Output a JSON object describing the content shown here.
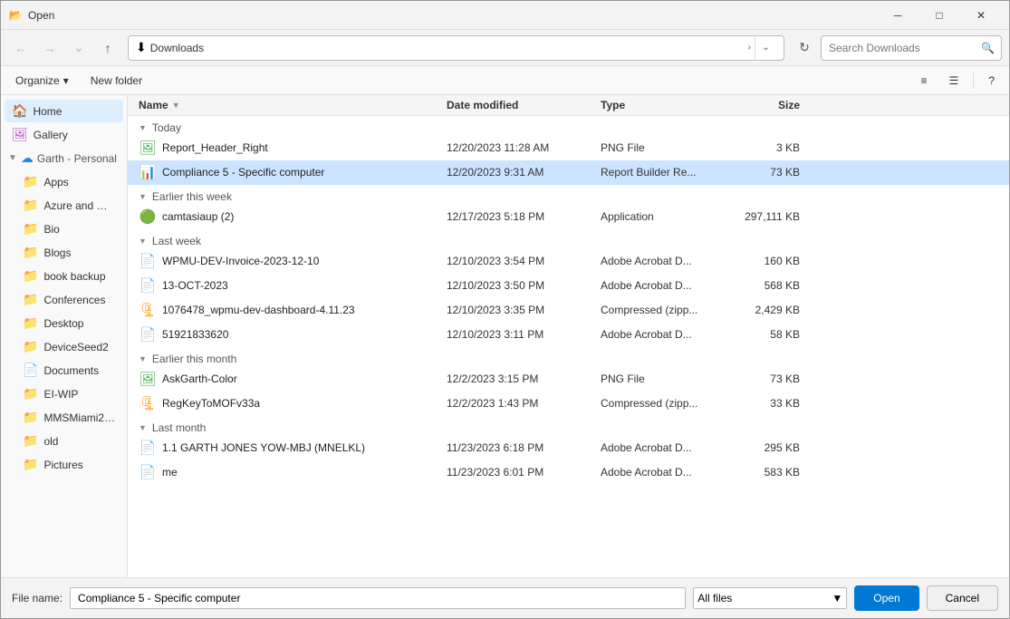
{
  "window": {
    "title": "Open",
    "title_icon": "📂"
  },
  "title_buttons": {
    "minimize": "─",
    "maximize": "□",
    "close": "✕"
  },
  "toolbar": {
    "back": "←",
    "forward": "→",
    "recent_locations": "⌄",
    "up": "↑",
    "download_icon": "⬇",
    "address": "Downloads",
    "address_chevron": "›",
    "refresh": "↻",
    "search_placeholder": "Search Downloads"
  },
  "secondary_toolbar": {
    "organize_label": "Organize",
    "organize_chevron": "▾",
    "new_folder_label": "New folder",
    "view_icons": "⊞",
    "view_details": "☰",
    "help": "?"
  },
  "sidebar": {
    "items": [
      {
        "id": "home",
        "icon": "🏠",
        "label": "Home",
        "selected": true,
        "indent": 0
      },
      {
        "id": "gallery",
        "icon": "🖼",
        "label": "Gallery",
        "selected": false,
        "indent": 0
      },
      {
        "id": "garth-personal",
        "icon": "☁",
        "label": "Garth - Personal",
        "selected": false,
        "indent": 0,
        "expandable": true,
        "expanded": true
      },
      {
        "id": "apps",
        "icon": "📁",
        "label": "Apps",
        "selected": false,
        "indent": 1
      },
      {
        "id": "azure",
        "icon": "📁",
        "label": "Azure and Mo...",
        "selected": false,
        "indent": 1
      },
      {
        "id": "bio",
        "icon": "📁",
        "label": "Bio",
        "selected": false,
        "indent": 1
      },
      {
        "id": "blogs",
        "icon": "📁",
        "label": "Blogs",
        "selected": false,
        "indent": 1
      },
      {
        "id": "book-backup",
        "icon": "📁",
        "label": "book backup",
        "selected": false,
        "indent": 1
      },
      {
        "id": "conferences",
        "icon": "📁",
        "label": "Conferences",
        "selected": false,
        "indent": 1
      },
      {
        "id": "desktop",
        "icon": "📁",
        "label": "Desktop",
        "selected": false,
        "indent": 1
      },
      {
        "id": "deviceseed2",
        "icon": "📁",
        "label": "DeviceSeed2",
        "selected": false,
        "indent": 1
      },
      {
        "id": "documents",
        "icon": "📄",
        "label": "Documents",
        "selected": false,
        "indent": 1
      },
      {
        "id": "el-wip",
        "icon": "📁",
        "label": "EI-WIP",
        "selected": false,
        "indent": 1
      },
      {
        "id": "mmsMiami202",
        "icon": "📁",
        "label": "MMSMiami202...",
        "selected": false,
        "indent": 1
      },
      {
        "id": "old",
        "icon": "📁",
        "label": "old",
        "selected": false,
        "indent": 1
      },
      {
        "id": "pictures",
        "icon": "📁",
        "label": "Pictures",
        "selected": false,
        "indent": 1
      }
    ]
  },
  "file_list": {
    "columns": {
      "name": "Name",
      "date": "Date modified",
      "type": "Type",
      "size": "Size",
      "sort_arrow": "▼"
    },
    "groups": [
      {
        "label": "Today",
        "files": [
          {
            "icon": "🖼",
            "icon_type": "png",
            "name": "Report_Header_Right",
            "date": "12/20/2023 11:28 AM",
            "type": "PNG File",
            "size": "3 KB",
            "selected": false
          },
          {
            "icon": "📊",
            "icon_type": "report",
            "name": "Compliance 5 - Specific computer",
            "date": "12/20/2023 9:31 AM",
            "type": "Report Builder Re...",
            "size": "73 KB",
            "selected": true
          }
        ]
      },
      {
        "label": "Earlier this week",
        "files": [
          {
            "icon": "🟢",
            "icon_type": "app",
            "name": "camtasiaup (2)",
            "date": "12/17/2023 5:18 PM",
            "type": "Application",
            "size": "297,111 KB",
            "selected": false
          }
        ]
      },
      {
        "label": "Last week",
        "files": [
          {
            "icon": "📄",
            "icon_type": "pdf",
            "name": "WPMU-DEV-Invoice-2023-12-10",
            "date": "12/10/2023 3:54 PM",
            "type": "Adobe Acrobat D...",
            "size": "160 KB",
            "selected": false
          },
          {
            "icon": "📄",
            "icon_type": "pdf",
            "name": "13-OCT-2023",
            "date": "12/10/2023 3:50 PM",
            "type": "Adobe Acrobat D...",
            "size": "568 KB",
            "selected": false
          },
          {
            "icon": "🗜",
            "icon_type": "zip",
            "name": "1076478_wpmu-dev-dashboard-4.11.23",
            "date": "12/10/2023 3:35 PM",
            "type": "Compressed (zipp...",
            "size": "2,429 KB",
            "selected": false
          },
          {
            "icon": "📄",
            "icon_type": "pdf",
            "name": "51921833620",
            "date": "12/10/2023 3:11 PM",
            "type": "Adobe Acrobat D...",
            "size": "58 KB",
            "selected": false
          }
        ]
      },
      {
        "label": "Earlier this month",
        "files": [
          {
            "icon": "🖼",
            "icon_type": "png",
            "name": "AskGarth-Color",
            "date": "12/2/2023 3:15 PM",
            "type": "PNG File",
            "size": "73 KB",
            "selected": false
          },
          {
            "icon": "🗜",
            "icon_type": "zip",
            "name": "RegKeyToMOFv33a",
            "date": "12/2/2023 1:43 PM",
            "type": "Compressed (zipp...",
            "size": "33 KB",
            "selected": false
          }
        ]
      },
      {
        "label": "Last month",
        "files": [
          {
            "icon": "📄",
            "icon_type": "pdf",
            "name": "1.1 GARTH JONES YOW-MBJ (MNELKL)",
            "date": "11/23/2023 6:18 PM",
            "type": "Adobe Acrobat D...",
            "size": "295 KB",
            "selected": false
          },
          {
            "icon": "📄",
            "icon_type": "pdf",
            "name": "me",
            "date": "11/23/2023 6:01 PM",
            "type": "Adobe Acrobat D...",
            "size": "583 KB",
            "selected": false
          }
        ]
      }
    ]
  },
  "bottom_bar": {
    "file_name_label": "File name:",
    "file_name_value": "Compliance 5 - Specific computer",
    "file_type_label": "All files",
    "open_label": "Open",
    "cancel_label": "Cancel"
  }
}
